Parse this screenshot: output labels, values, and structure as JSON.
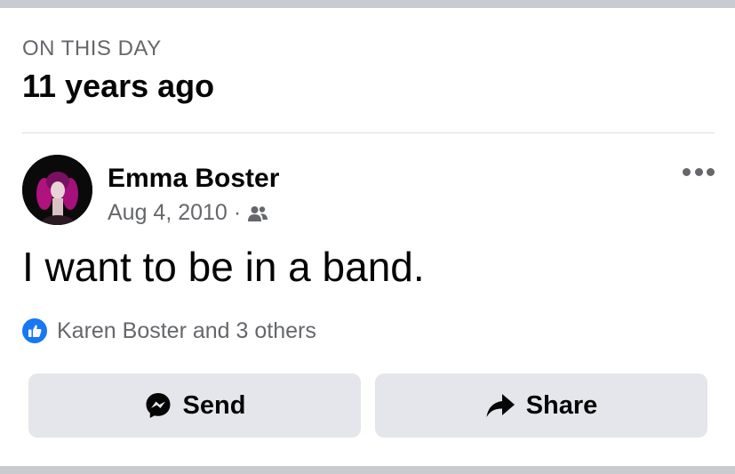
{
  "memory": {
    "section_label": "ON THIS DAY",
    "title": "11 years ago"
  },
  "post": {
    "author": "Emma Boster",
    "date": "Aug 4, 2010",
    "separator": "·",
    "audience_icon": "friends-icon",
    "text": "I want to be in a band.",
    "more_icon": "more-options-icon"
  },
  "reactions": {
    "icon": "like-icon",
    "summary": "Karen Boster and 3 others"
  },
  "actions": {
    "send_label": "Send",
    "send_icon": "messenger-icon",
    "share_label": "Share",
    "share_icon": "share-arrow-icon"
  },
  "colors": {
    "like_blue": "#1877f2",
    "button_bg": "#e4e6eb",
    "secondary_text": "#65676b"
  }
}
